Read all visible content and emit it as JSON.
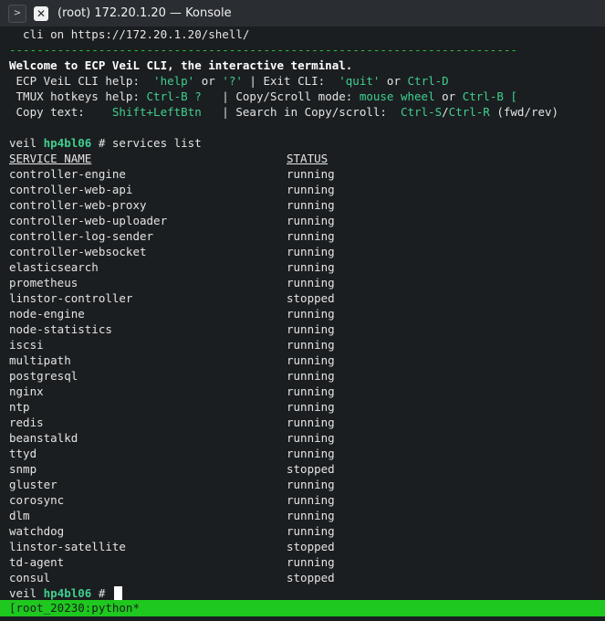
{
  "window": {
    "title": "(root) 172.20.1.20 — Konsole"
  },
  "terminal": {
    "cli_url_line": "  cli on https://172.20.1.20/shell/",
    "separator": "--------------------------------------------------------------------------",
    "welcome": "Welcome to ECP VeiL CLI, the interactive terminal.",
    "help_line": {
      "p1": " ECP VeiL CLI help:  ",
      "k1": "'help'",
      "p2": " or ",
      "k2": "'?'",
      "p3": " | Exit CLI:  ",
      "k3": "'quit'",
      "p4": " or ",
      "k4": "Ctrl-D"
    },
    "tmux_line": {
      "p1": " TMUX hotkeys help: ",
      "k1": "Ctrl-B ?",
      "p2": "   | Copy/Scroll mode: ",
      "k2": "mouse wheel",
      "p3": " or ",
      "k3": "Ctrl-B ["
    },
    "copy_line": {
      "p1": " Copy text:    ",
      "k1": "Shift+LeftBtn",
      "p2": "   | Search in Copy/scroll:  ",
      "k2": "Ctrl-S",
      "p3": "/",
      "k3": "Ctrl-R",
      "p4": " (fwd/rev)"
    },
    "prompt_prefix": "veil ",
    "host": "hp4bl06",
    "command": " # services list",
    "prompt_end": " # ",
    "table_headers": {
      "service": "SERVICE NAME",
      "status": "STATUS"
    },
    "services": [
      {
        "name": "controller-engine",
        "status": "running"
      },
      {
        "name": "controller-web-api",
        "status": "running"
      },
      {
        "name": "controller-web-proxy",
        "status": "running"
      },
      {
        "name": "controller-web-uploader",
        "status": "running"
      },
      {
        "name": "controller-log-sender",
        "status": "running"
      },
      {
        "name": "controller-websocket",
        "status": "running"
      },
      {
        "name": "elasticsearch",
        "status": "running"
      },
      {
        "name": "prometheus",
        "status": "running"
      },
      {
        "name": "linstor-controller",
        "status": "stopped"
      },
      {
        "name": "node-engine",
        "status": "running"
      },
      {
        "name": "node-statistics",
        "status": "running"
      },
      {
        "name": "iscsi",
        "status": "running"
      },
      {
        "name": "multipath",
        "status": "running"
      },
      {
        "name": "postgresql",
        "status": "running"
      },
      {
        "name": "nginx",
        "status": "running"
      },
      {
        "name": "ntp",
        "status": "running"
      },
      {
        "name": "redis",
        "status": "running"
      },
      {
        "name": "beanstalkd",
        "status": "running"
      },
      {
        "name": "ttyd",
        "status": "running"
      },
      {
        "name": "snmp",
        "status": "stopped"
      },
      {
        "name": "gluster",
        "status": "running"
      },
      {
        "name": "corosync",
        "status": "running"
      },
      {
        "name": "dlm",
        "status": "running"
      },
      {
        "name": "watchdog",
        "status": "running"
      },
      {
        "name": "linstor-satellite",
        "status": "stopped"
      },
      {
        "name": "td-agent",
        "status": "running"
      },
      {
        "name": "consul",
        "status": "stopped"
      }
    ]
  },
  "tmux_status": "[root_20230:python*",
  "colors": {
    "accent_green": "#3fcf8f",
    "status_bar": "#1ec81e",
    "background": "#1b1e20"
  }
}
